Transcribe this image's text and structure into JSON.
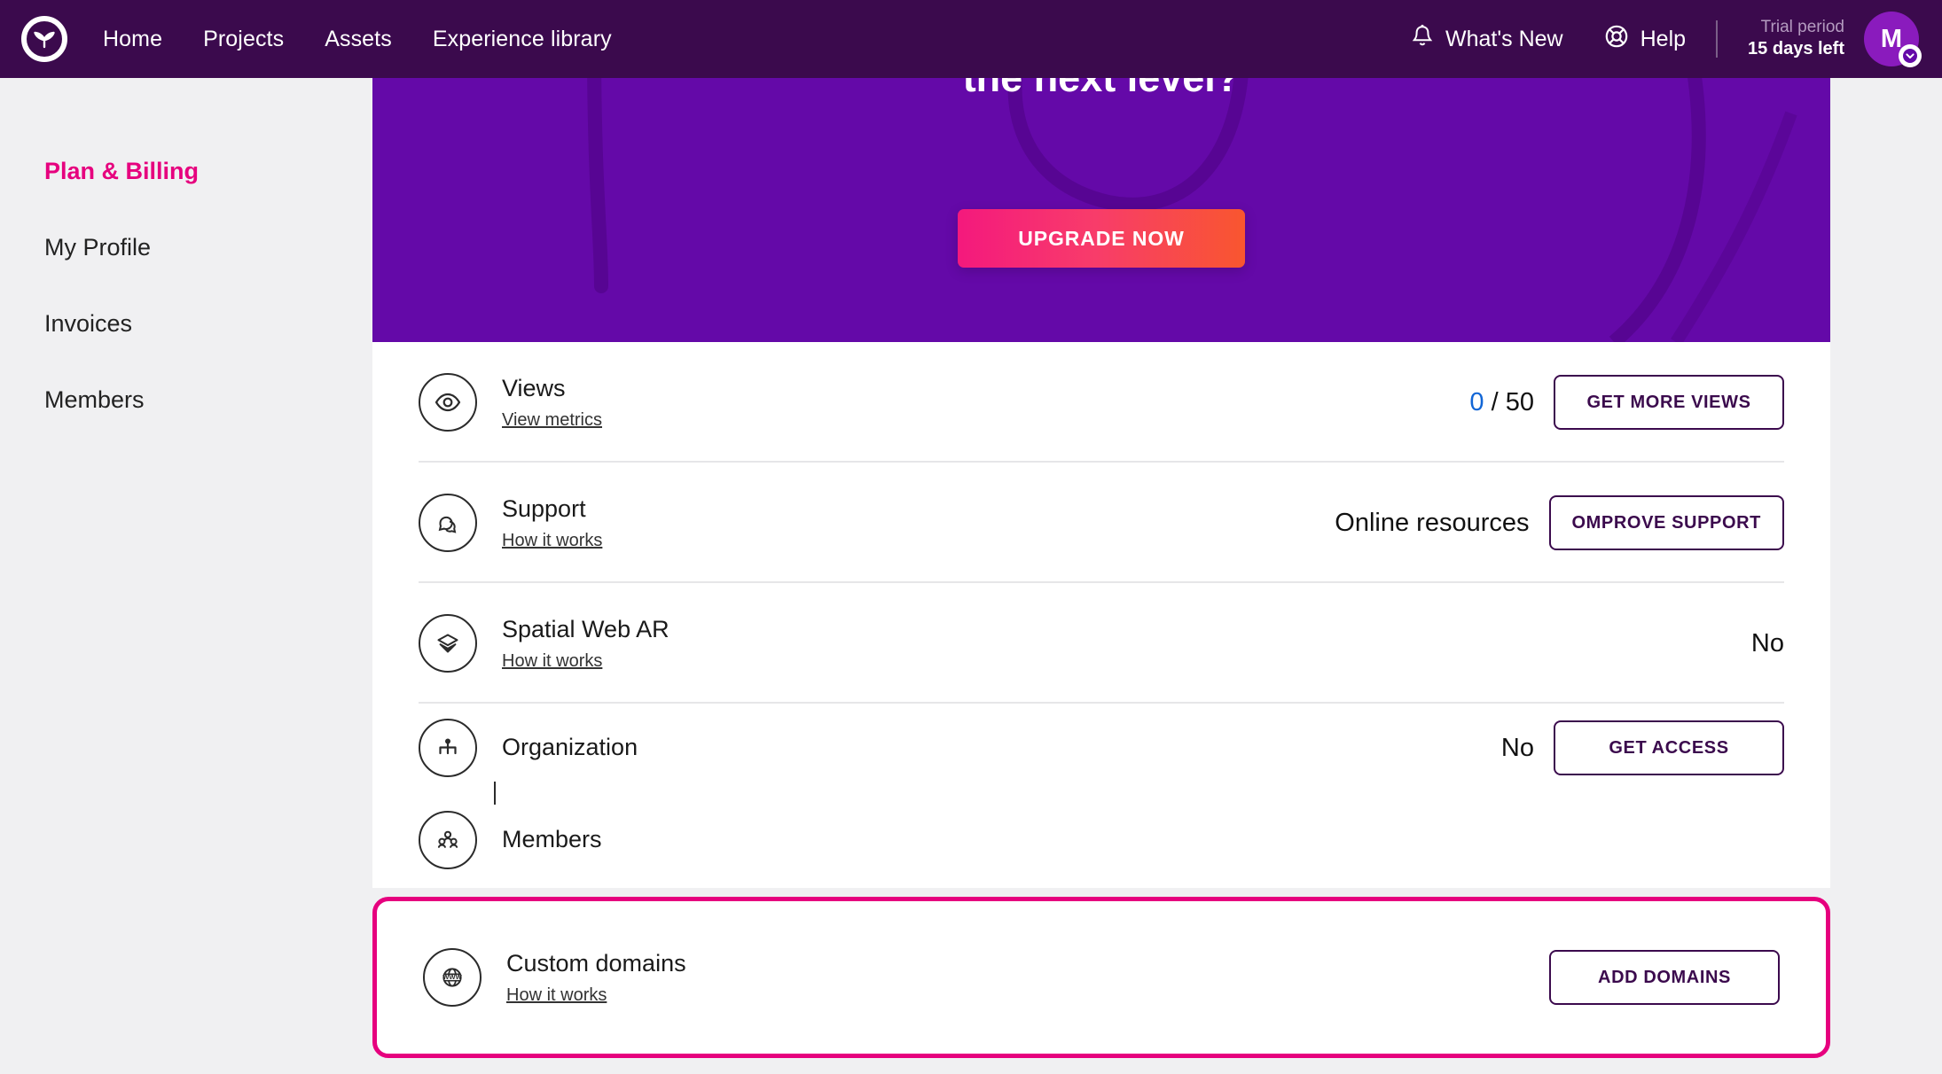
{
  "header": {
    "logo_icon": "brand-logo-icon",
    "nav": [
      {
        "label": "Home"
      },
      {
        "label": "Projects"
      },
      {
        "label": "Assets"
      },
      {
        "label": "Experience library"
      }
    ],
    "whats_new": {
      "label": "What's New",
      "icon": "bell-icon"
    },
    "help": {
      "label": "Help",
      "icon": "lifebuoy-icon"
    },
    "trial": {
      "line1": "Trial period",
      "line2": "15 days left"
    },
    "avatar": {
      "initial": "M",
      "chevron": "chevron-down-icon"
    },
    "bg_color": "#3b0a4d"
  },
  "sidebar": {
    "items": [
      {
        "label": "Plan & Billing",
        "active": true
      },
      {
        "label": "My Profile",
        "active": false
      },
      {
        "label": "Invoices",
        "active": false
      },
      {
        "label": "Members",
        "active": false
      }
    ],
    "active_color": "#e6007e"
  },
  "banner": {
    "headline": "the next level?",
    "cta_label": "UPGRADE NOW",
    "bg_color": "#6409a8",
    "cta_gradient_from": "#f4197d",
    "cta_gradient_to": "#f9562f"
  },
  "rows": [
    {
      "icon": "eye-icon",
      "title": "Views",
      "link": "View metrics",
      "value_highlight": "0",
      "value_rest": " / 50",
      "button": "GET MORE VIEWS"
    },
    {
      "icon": "chat-bubbles-icon",
      "title": "Support",
      "link": "How it works",
      "value": "Online resources",
      "button": "OMPROVE SUPPORT"
    },
    {
      "icon": "layers-icon",
      "title": "Spatial Web AR",
      "link": "How it works",
      "value": "No",
      "button": null
    },
    {
      "icon": "org-chart-icon",
      "title": "Organization",
      "link": null,
      "value": "No",
      "button": "GET ACCESS"
    },
    {
      "icon": "people-group-icon",
      "title": "Members",
      "link": null,
      "value": null,
      "button": null
    }
  ],
  "highlighted_row": {
    "icon": "globe-www-icon",
    "title": "Custom domains",
    "link": "How it works",
    "button": "ADD DOMAINS",
    "highlight_color": "#e6007e"
  }
}
